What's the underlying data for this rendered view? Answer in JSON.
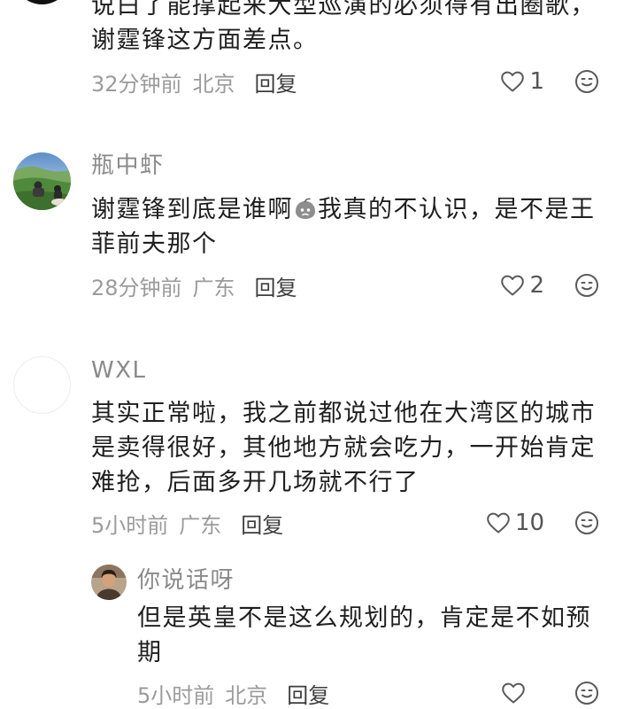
{
  "colors": {
    "background": "#ffffff",
    "text": "#1f1f1f",
    "meta": "#9b9b9b",
    "username": "#8a8a8a",
    "reply": "#3d3d3d",
    "icon": "#5a5a5a"
  },
  "icons": {
    "like": "heart-outline-icon",
    "emoji_reaction": "face-icon",
    "inline_sticker": "sticker-emoji-icon"
  },
  "comments": [
    {
      "text_lines": [
        "说白了能撑起来大型巡演的必须得有出圈歌，",
        "谢霆锋这方面差点。"
      ],
      "time": "32分钟前",
      "location": "北京",
      "reply_label": "回复",
      "like_count": "1"
    },
    {
      "username": "瓶中虾",
      "text_lines": [
        {
          "before": "谢霆锋到底是谁啊",
          "emoji": "sticker-emoji-icon",
          "after": "我真的不认识，是不是王"
        },
        "菲前夫那个"
      ],
      "time": "28分钟前",
      "location": "广东",
      "reply_label": "回复",
      "like_count": "2"
    },
    {
      "username": "WXL",
      "text_lines": [
        "其实正常啦，我之前都说过他在大湾区的城市",
        "是卖得很好，其他地方就会吃力，一开始肯定",
        "难抢，后面多开几场就不行了"
      ],
      "time": "5小时前",
      "location": "广东",
      "reply_label": "回复",
      "like_count": "10",
      "replies": [
        {
          "username": "你说话呀",
          "text_lines": [
            "但是英皇不是这么规划的，肯定是不如预",
            "期"
          ],
          "time": "5小时前",
          "location": "北京",
          "reply_label": "回复"
        }
      ]
    }
  ]
}
